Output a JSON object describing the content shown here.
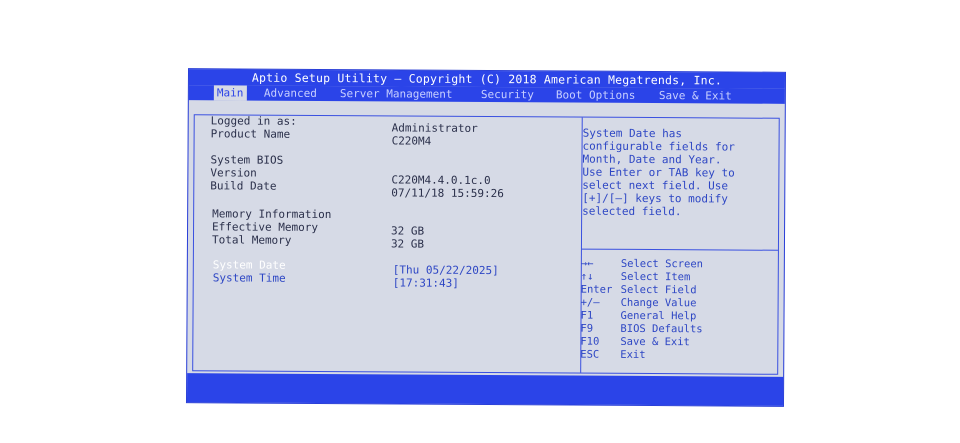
{
  "title": "Aptio Setup Utility – Copyright (C) 2018 American Megatrends, Inc.",
  "tabs": [
    {
      "label": "Main",
      "active": true
    },
    {
      "label": "Advanced"
    },
    {
      "label": "Server Management"
    },
    {
      "label": "Security"
    },
    {
      "label": "Boot Options"
    },
    {
      "label": "Save & Exit"
    }
  ],
  "main": {
    "logged_in_label": "Logged in as:",
    "logged_in_value": "Administrator",
    "product_name_label": "Product Name",
    "product_name_value": "C220M4",
    "system_bios_label": "System BIOS",
    "version_label": "Version",
    "version_value": "C220M4.4.0.1c.0",
    "build_date_label": "Build Date",
    "build_date_value": "07/11/18 15:59:26",
    "memory_info_label": "Memory Information",
    "effective_memory_label": "Effective Memory",
    "effective_memory_value": "32 GB",
    "total_memory_label": "Total Memory",
    "total_memory_value": "32 GB",
    "system_date_label": "System Date",
    "system_date_value": "[Thu 05/22/2025]",
    "system_time_label": "System Time",
    "system_time_value": "[17:31:43]"
  },
  "help": {
    "description": "System Date has\nconfigurable fields for\nMonth, Date and Year.\nUse Enter or TAB key to\nselect next field. Use\n[+]/[–] keys to modify\nselected field.",
    "keys": [
      {
        "key": "→←",
        "action": "Select Screen"
      },
      {
        "key": "↑↓",
        "action": "Select Item"
      },
      {
        "key": "Enter",
        "action": "Select Field"
      },
      {
        "key": "+/–",
        "action": "Change Value"
      },
      {
        "key": "F1",
        "action": "General Help"
      },
      {
        "key": "F9",
        "action": "BIOS Defaults"
      },
      {
        "key": "F10",
        "action": "Save & Exit"
      },
      {
        "key": "ESC",
        "action": "Exit"
      }
    ]
  },
  "colors": {
    "bios_blue": "#2b44e8",
    "panel_bg": "#d6dae6",
    "text_dark": "#2a2f4a",
    "text_blue": "#2d46c4"
  }
}
